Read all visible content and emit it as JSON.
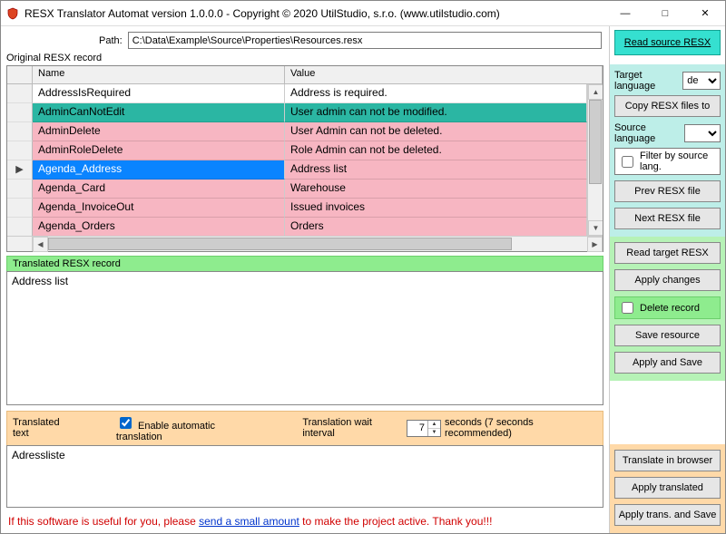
{
  "window": {
    "title": "RESX Translator Automat version 1.0.0.0 - Copyright © 2020 UtilStudio, s.r.o. (www.utilstudio.com)"
  },
  "path": {
    "label": "Path:",
    "value": "C:\\Data\\Example\\Source\\Properties\\Resources.resx"
  },
  "section_original": "Original RESX record",
  "grid": {
    "col_name": "Name",
    "col_value": "Value",
    "rows": [
      {
        "name": "AddressIsRequired",
        "value": "Address is required.",
        "style": "default",
        "marker": ""
      },
      {
        "name": "AdminCanNotEdit",
        "value": "User admin can not be modified.",
        "style": "teal",
        "marker": ""
      },
      {
        "name": "AdminDelete",
        "value": "User Admin can not be deleted.",
        "style": "pink",
        "marker": ""
      },
      {
        "name": "AdminRoleDelete",
        "value": "Role Admin can not be deleted.",
        "style": "pink",
        "marker": ""
      },
      {
        "name": "Agenda_Address",
        "value": "Address list",
        "style": "selected",
        "marker": "▶"
      },
      {
        "name": "Agenda_Card",
        "value": "Warehouse",
        "style": "pink",
        "marker": ""
      },
      {
        "name": "Agenda_InvoiceOut",
        "value": "Issued invoices",
        "style": "pink",
        "marker": ""
      },
      {
        "name": "Agenda_Orders",
        "value": "Orders",
        "style": "pink",
        "marker": ""
      }
    ]
  },
  "section_translated_record": "Translated RESX record",
  "translated_record_value": "Address list",
  "translated_text": {
    "bar_label": "Translated text",
    "enable_auto": "Enable automatic translation",
    "interval_label": "Translation wait interval",
    "interval_value": "7",
    "interval_suffix": "seconds (7 seconds recommended)",
    "value": "Adressliste"
  },
  "footer": {
    "prefix": "If this software is useful for you, please ",
    "link": "send a small amount",
    "suffix": " to make the project active. Thank you!!!"
  },
  "side": {
    "read_source": "Read source RESX",
    "target_lang_label": "Target language",
    "target_lang_value": "de",
    "copy_resx": "Copy RESX files to",
    "source_lang_label": "Source language",
    "source_lang_value": "",
    "filter_by_source": "Filter by source lang.",
    "prev_file": "Prev RESX file",
    "next_file": "Next RESX file",
    "read_target": "Read target RESX",
    "apply_changes": "Apply changes",
    "delete_record": "Delete record",
    "save_resource": "Save resource",
    "apply_and_save": "Apply and Save",
    "translate_in_browser": "Translate in browser",
    "apply_translated": "Apply translated",
    "apply_trans_save": "Apply trans. and Save"
  }
}
